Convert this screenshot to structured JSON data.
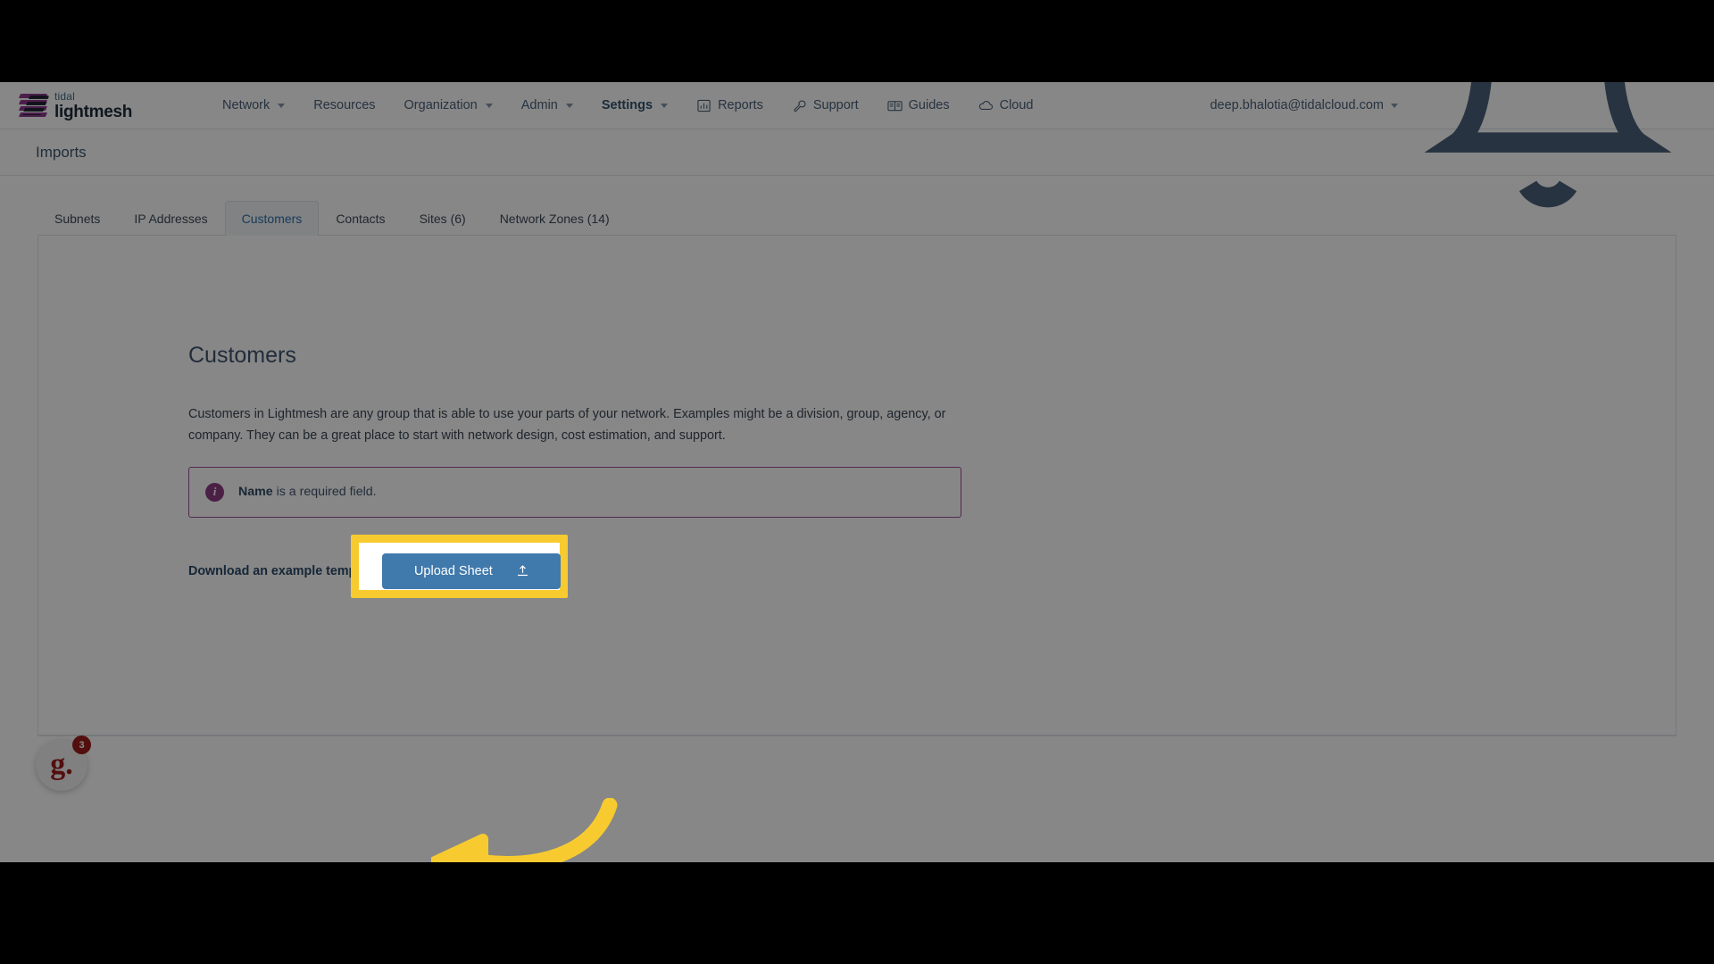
{
  "brand": {
    "top": "tidal",
    "bottom": "lightmesh"
  },
  "nav": {
    "items": [
      {
        "label": "Network",
        "caret": true,
        "active": false,
        "icon": ""
      },
      {
        "label": "Resources",
        "caret": false,
        "active": false,
        "icon": ""
      },
      {
        "label": "Organization",
        "caret": true,
        "active": false,
        "icon": ""
      },
      {
        "label": "Admin",
        "caret": true,
        "active": false,
        "icon": ""
      },
      {
        "label": "Settings",
        "caret": true,
        "active": true,
        "icon": ""
      }
    ],
    "right_items": [
      {
        "label": "Reports",
        "icon": "bar-chart-icon"
      },
      {
        "label": "Support",
        "icon": "wrench-icon"
      },
      {
        "label": "Guides",
        "icon": "book-icon"
      },
      {
        "label": "Cloud",
        "icon": "cloud-icon"
      }
    ],
    "user_email": "deep.bhalotia@tidalcloud.com",
    "notification_icon": "bell-icon"
  },
  "header": {
    "title": "Imports"
  },
  "tabs": [
    {
      "label": "Subnets",
      "active": false
    },
    {
      "label": "IP Addresses",
      "active": false
    },
    {
      "label": "Customers",
      "active": true
    },
    {
      "label": "Contacts",
      "active": false
    },
    {
      "label": "Sites (6)",
      "active": false
    },
    {
      "label": "Network Zones (14)",
      "active": false
    }
  ],
  "main": {
    "section_title": "Customers",
    "blurb": "Customers in Lightmesh are any group that is able to use your parts of your network. Examples might be a division, group, agency, or company. They can be a great place to start with network design, cost estimation, and support.",
    "alert": {
      "icon": "info-icon",
      "bold": "Name",
      "rest": " is a required field."
    },
    "download_link": "Download an example template",
    "upload_button": "Upload Sheet",
    "upload_icon": "upload-icon"
  },
  "chat_widget": {
    "label": "g.",
    "count": "3"
  },
  "colors": {
    "accent_blue": "#4079ab",
    "brand_purple": "#8e3a8e",
    "alert_purple": "#9c4f93",
    "highlight_yellow": "#f7cb2f",
    "nav_text": "#4a6179"
  }
}
